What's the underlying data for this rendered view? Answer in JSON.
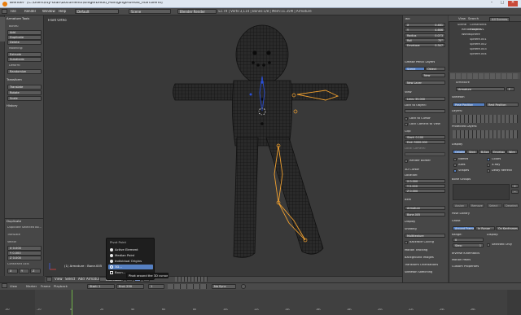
{
  "window": {
    "title": "Blender* [C:\\Users\\lity-Gian\\Documents\\Gingerbread_Man\\gingerbread_man.blend]",
    "min": "–",
    "max": "□",
    "close": "✕"
  },
  "header": {
    "menus": [
      "File",
      "Render",
      "Window",
      "Help"
    ],
    "layout": "Default",
    "scene": "Scene",
    "engine": "Blender Render",
    "stats": "v2.79 | Verts:3,114 | Bones:1/8 | Mem:11.35M | Armature"
  },
  "left_panel": {
    "tabs": [
      "Tools",
      "Create",
      "Relations",
      "Animation",
      "Physics",
      "Grease Pencil"
    ],
    "section_armature": "Armature Tools",
    "bones_label": "Bones:",
    "buttons_a": [
      "Add",
      "Duplicate",
      "Delete"
    ],
    "modeling_label": "Modeling:",
    "buttons_b": [
      "Extrude",
      "Subdivide"
    ],
    "deform_label": "Deform:",
    "buttons_c": [
      "Randomize"
    ],
    "transform_head": "Transform",
    "buttons_d": [
      "Translate",
      "Rotate",
      "Scale"
    ],
    "history_head": "History",
    "op_head": "Duplicate",
    "op_item": "Duplicate Selected Bo...",
    "op_sub": "Translate",
    "vector_label": "Vector",
    "vector": [
      "X  0.000",
      "Y  0.000",
      "Z  0.000"
    ],
    "constraint_label": "Constraint Axis",
    "axes": [
      "X",
      "Y",
      "Z"
    ]
  },
  "viewport": {
    "label": "Front Ortho",
    "status": "(1) Armature : Bone.005",
    "menus": [
      "View",
      "Select",
      "Add",
      "Armature"
    ],
    "mode": "Edit Mode"
  },
  "pivot_menu": {
    "title": "Pivot Point",
    "items": [
      "Active Element",
      "Median Point",
      "Individual Origins",
      "3D Cursor",
      "Bounding Box Center"
    ],
    "items_visible": [
      "Active Element",
      "Median Point",
      "Individual Origins",
      "3D...",
      "Boun..."
    ],
    "selected_index": 3,
    "tooltip": "Pivot around the 3D cursor."
  },
  "n_panel": {
    "fields": [
      {
        "label": "Tail:",
        "value": ""
      },
      {
        "label": "X",
        "value": "0.481"
      },
      {
        "label": "Y",
        "value": "4.666"
      },
      {
        "label": "Radius",
        "value": "0.073"
      },
      {
        "label": "Roll",
        "value": "75°"
      },
      {
        "label": "Envelope",
        "value": "0.347"
      }
    ],
    "grease_head": "Grease Pencil Layers",
    "scene_btn": "Scene",
    "object_btn": "Object",
    "new_btn": "New",
    "new_layer": "New Layer",
    "view_head": "View",
    "lens": "Lens:  35.000",
    "lock_obj": "Lock to Object:",
    "lock_cursor": "Lock to Cursor",
    "lock_cam": "Lock Camera to View",
    "clip_head": "Clip:",
    "clip_start": "Start:  0.100",
    "clip_end": "End:  5000.000",
    "local_cam": "Local Camera:",
    "render_border": "Render Border",
    "cursor_head": "3D Cursor",
    "location": "Location:",
    "cursor_vals": [
      "X  0.000",
      "Y  0.000",
      "Z  0.000"
    ],
    "item_head": "Item",
    "item_obj": "Armature",
    "item_bone": "Bone.005",
    "display_head": "Display",
    "shading_head": "Shading",
    "shading_val": "Multitexture",
    "backface": "Backface Culling",
    "motion_head": "Motion Tracking",
    "bg_head": "Background Images",
    "tf_head": "Transform Orientations",
    "sk_head": "Skeleton Sketching"
  },
  "outliner": {
    "menus": [
      "View",
      "Search",
      "All Scenes"
    ],
    "items": [
      "Scene",
      "RenderLayers",
      "World",
      "Constraints",
      "Plane.001",
      "Sphere",
      "Sphere.001",
      "Sphere.002",
      "Sphere.003",
      "Sphere.004"
    ]
  },
  "properties": {
    "crumb": "Armature",
    "obj_name": "Armature",
    "f_label": "F",
    "skeleton_head": "Skeleton",
    "pose_pos": "Pose Position",
    "rest_pos": "Rest Position",
    "layers_label": "Layers:",
    "protected_label": "Protected Layers:",
    "display_head": "Display",
    "display_btns": [
      "Octahedral",
      "Stick",
      "B-Bone",
      "Envelope",
      "Wire"
    ],
    "opt_left": [
      "Names",
      "Axes",
      "Shapes"
    ],
    "opt_right": [
      "Colors",
      "X-Ray",
      "Delay Refresh"
    ],
    "bonegroups_head": "Bone Groups",
    "assign": "Assign",
    "remove": "Remove",
    "select": "Select",
    "deselect": "Deselect",
    "poselib_head": "Pose Library",
    "ghost_head": "Ghost",
    "ghost_btns": [
      "Around Frame",
      "In Range",
      "On Keyframes"
    ],
    "range_label": "Range:",
    "range_val": "0",
    "display_label": "Display:",
    "step_label": "Step:",
    "step_val": "1",
    "sel_only": "Selected Only",
    "ik_head": "Inverse Kinematics",
    "mpaths_head": "Motion Paths",
    "custom_head": "Custom Properties"
  },
  "timeline": {
    "menus": [
      "View",
      "Marker",
      "Frame",
      "Playback"
    ],
    "start": "Start:  1",
    "end": "End:  250",
    "current": "1",
    "sync": "No Sync",
    "ticks": [
      "-40",
      "-20",
      "0",
      "20",
      "40",
      "60",
      "80",
      "100",
      "120",
      "140",
      "160",
      "180",
      "200",
      "220",
      "240",
      "260"
    ]
  }
}
